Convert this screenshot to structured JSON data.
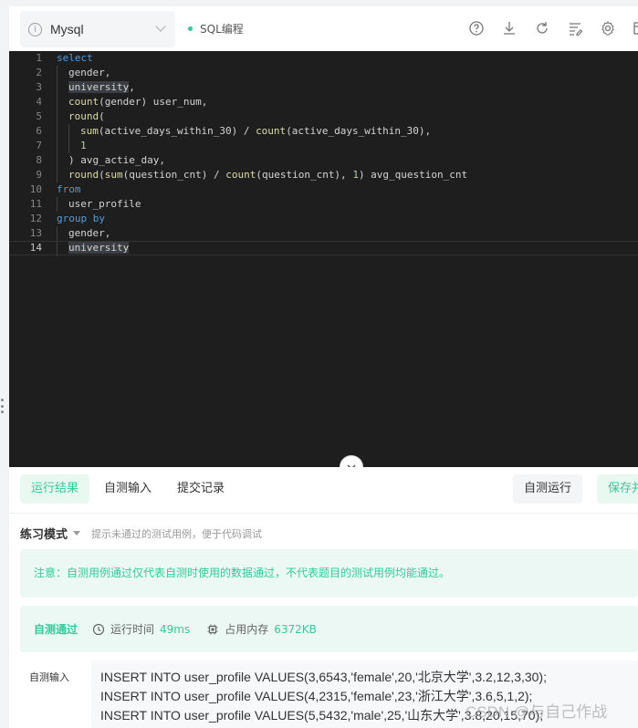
{
  "toolbar": {
    "language": "Mysql",
    "language_icon": "question-circle-icon",
    "mode_label": "SQL编程",
    "icons": [
      "help-icon",
      "download-icon",
      "refresh-icon",
      "format-icon",
      "settings-icon",
      "window-icon"
    ]
  },
  "editor": {
    "lines": [
      {
        "n": "1",
        "text": "select"
      },
      {
        "n": "2",
        "text": "  gender,"
      },
      {
        "n": "3",
        "text": "  university,"
      },
      {
        "n": "4",
        "text": "  count(gender) user_num,"
      },
      {
        "n": "5",
        "text": "  round("
      },
      {
        "n": "6",
        "text": "    sum(active_days_within_30) / count(active_days_within_30),"
      },
      {
        "n": "7",
        "text": "    1"
      },
      {
        "n": "8",
        "text": "  ) avg_actie_day,"
      },
      {
        "n": "9",
        "text": "  round(sum(question_cnt) / count(question_cnt), 1) avg_question_cnt"
      },
      {
        "n": "10",
        "text": "from"
      },
      {
        "n": "11",
        "text": "  user_profile"
      },
      {
        "n": "12",
        "text": "group by"
      },
      {
        "n": "13",
        "text": "  gender,"
      },
      {
        "n": "14",
        "text": "  university"
      }
    ],
    "current_line": 14
  },
  "panel": {
    "tabs": [
      "运行结果",
      "自测输入",
      "提交记录"
    ],
    "active_tab": "运行结果",
    "run_button": "自测运行",
    "save_button": "保存并提交",
    "practice_mode": "练习模式",
    "practice_hint": "提示未通过的测试用例，便于代码调试",
    "notice": "注意：自测用例通过仅代表自测时使用的数据通过，不代表题目的测试用例均能通过。",
    "result": {
      "status": "自测通过",
      "time_label": "运行时间",
      "time_value": "49ms",
      "memory_label": "占用内存",
      "memory_value": "6372KB"
    },
    "selftest_label": "自测输入",
    "inputs": [
      "INSERT INTO user_profile VALUES(3,6543,'female',20,'北京大学',3.2,12,3,30);",
      "INSERT INTO user_profile VALUES(4,2315,'female',23,'浙江大学',3.6,5,1,2);",
      "INSERT INTO user_profile VALUES(5,5432,'male',25,'山东大学',3.8,20,15,70);"
    ]
  },
  "watermark": "CSDN @与自己作战"
}
